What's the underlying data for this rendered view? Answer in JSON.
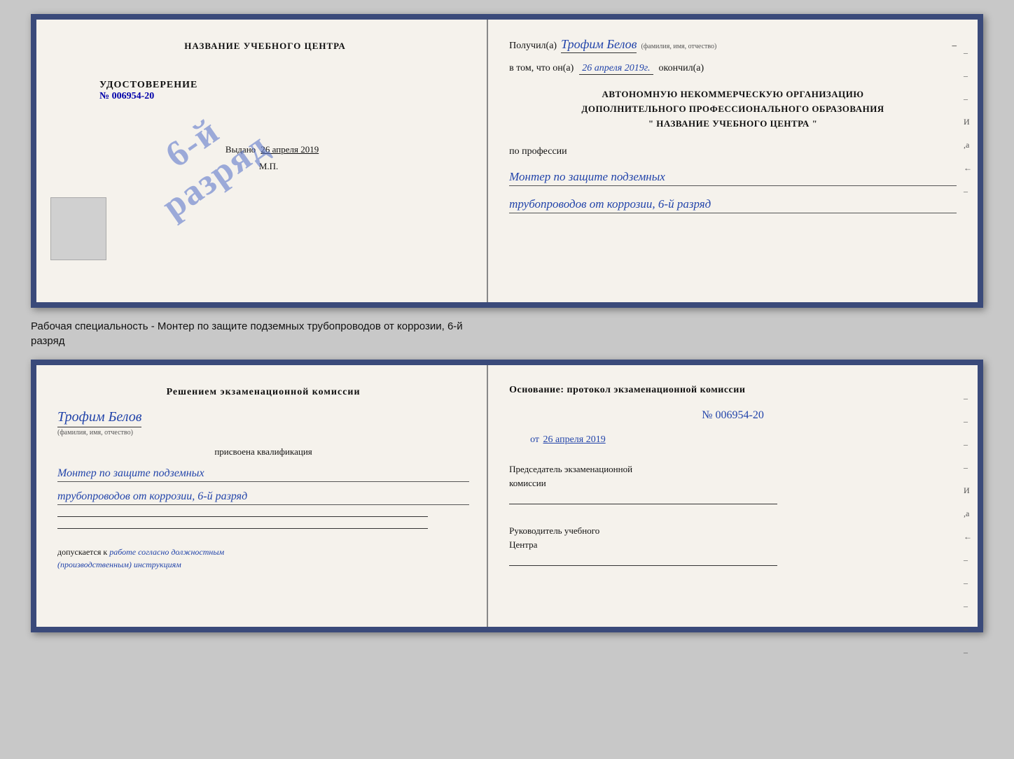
{
  "page": {
    "background": "#c8c8c8"
  },
  "doc_top": {
    "left": {
      "training_center_title": "НАЗВАНИЕ УЧЕБНОГО ЦЕНТРА",
      "certificate_label": "УДОСТОВЕРЕНИЕ",
      "certificate_number": "№ 006954-20",
      "issued_label": "Выдано",
      "issued_date": "26 апреля 2019",
      "mp_label": "М.П.",
      "stamp_line1": "6-й",
      "stamp_line2": "разряд"
    },
    "right": {
      "received_label": "Получил(а)",
      "received_name": "Трофим Белов",
      "received_name_hint": "(фамилия, имя, отчество)",
      "dash": "–",
      "in_that_label": "в том, что он(а)",
      "completed_date": "26 апреля 2019г.",
      "completed_label": "окончил(а)",
      "org_line1": "АВТОНОМНУЮ НЕКОММЕРЧЕСКУЮ ОРГАНИЗАЦИЮ",
      "org_line2": "ДОПОЛНИТЕЛЬНОГО ПРОФЕССИОНАЛЬНОГО ОБРАЗОВАНИЯ",
      "org_line3": "\"   НАЗВАНИЕ УЧЕБНОГО ЦЕНТРА   \"",
      "profession_label": "по профессии",
      "profession_text1": "Монтер по защите подземных",
      "profession_text2": "трубопроводов от коррозии, 6-й разряд"
    }
  },
  "specialty_text": {
    "line1": "Рабочая специальность - Монтер по защите подземных трубопроводов от коррозии, 6-й",
    "line2": "разряд"
  },
  "doc_bottom": {
    "left": {
      "decision_title": "Решением  экзаменационной  комиссии",
      "person_name": "Трофим Белов",
      "name_hint": "(фамилия, имя, отчество)",
      "assigned_label": "присвоена квалификация",
      "qualification1": "Монтер по защите подземных",
      "qualification2": "трубопроводов от коррозии, 6-й разряд",
      "allowed_prefix": "допускается к",
      "allowed_italic": "работе согласно должностным",
      "allowed_italic2": "(производственным) инструкциям"
    },
    "right": {
      "basis_label": "Основание:  протокол  экзаменационной  комиссии",
      "protocol_number": "№  006954-20",
      "protocol_date_prefix": "от",
      "protocol_date": "26 апреля 2019",
      "committee_label1": "Председатель экзаменационной",
      "committee_label2": "комиссии",
      "head_label1": "Руководитель учебного",
      "head_label2": "Центра"
    }
  },
  "margin_dashes": [
    "–",
    "–",
    "–",
    "И",
    ",а",
    "←",
    "–",
    "–",
    "–",
    "–"
  ],
  "margin_dashes_bottom": [
    "–",
    "–",
    "–",
    "–",
    "И",
    ",а",
    "←",
    "–",
    "–",
    "–",
    "–",
    "–"
  ]
}
